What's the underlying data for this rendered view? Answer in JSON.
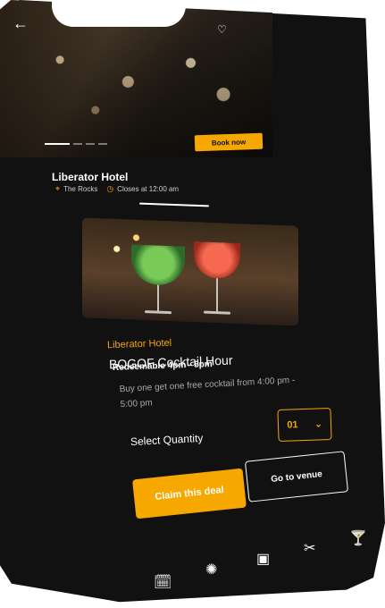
{
  "header": {
    "back_icon": "arrow-left-icon",
    "favorite_icon": "heart-icon",
    "book_button": "Book now",
    "carousel": {
      "count": 4,
      "active": 0
    }
  },
  "venue": {
    "name": "Liberator Hotel",
    "location": "The Rocks",
    "hours": "Closes at 12:00 am"
  },
  "deal": {
    "venue": "Liberator Hotel",
    "title": "BOGOF Cocktail Hour",
    "redeemable": "Redeemable 4pm - 5pm",
    "description": "Buy one get one free cocktail from 4:00 pm - 5:00 pm",
    "quantity_label": "Select Quantity",
    "quantity_value": "01",
    "claim_label": "Claim this deal",
    "venue_button": "Go to venue"
  },
  "nav": {
    "items": [
      {
        "icon": "calendar-icon"
      },
      {
        "icon": "discount-badge-icon"
      },
      {
        "icon": "calendar-add-icon"
      },
      {
        "icon": "food-icon"
      },
      {
        "icon": "cocktail-icon"
      }
    ]
  },
  "colors": {
    "accent": "#f6a700",
    "background": "#111111",
    "text": "#ffffff"
  }
}
